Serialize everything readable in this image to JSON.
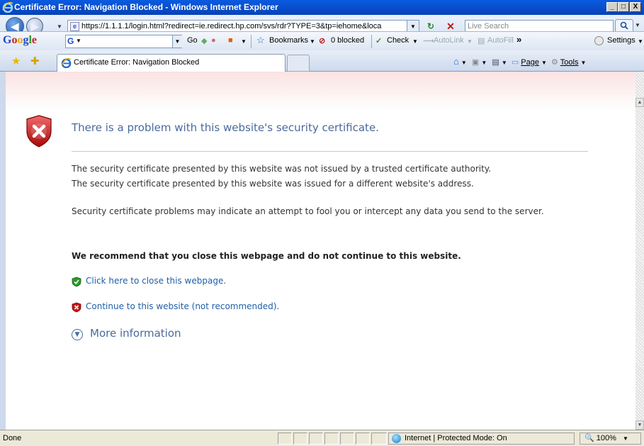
{
  "window": {
    "title": "Certificate Error: Navigation Blocked - Windows Internet Explorer",
    "min_glyph": "_",
    "max_glyph": "□",
    "close_glyph": "X"
  },
  "addressbar": {
    "url": "https://1.1.1.1/login.html?redirect=ie.redirect.hp.com/svs/rdr?TYPE=3&tp=iehome&loca",
    "search_placeholder": "Live Search"
  },
  "googlebar": {
    "logo": [
      "G",
      "o",
      "o",
      "g",
      "l",
      "e"
    ],
    "search_prefix": "G",
    "go_label": "Go",
    "bookmarks_label": "Bookmarks",
    "blocked_label": "0 blocked",
    "check_label": "Check",
    "autolink_label": "AutoLink",
    "autofill_label": "AutoFill",
    "more_label": "»",
    "settings_label": "Settings"
  },
  "tabs": {
    "active_label": "Certificate Error: Navigation Blocked"
  },
  "commandbar": {
    "page_label": "Page",
    "tools_label": "Tools"
  },
  "content": {
    "headline": "There is a problem with this website's security certificate.",
    "p1_line1": "The security certificate presented by this website was not issued by a trusted certificate authority.",
    "p1_line2": "The security certificate presented by this website was issued for a different website's address.",
    "p2": "Security certificate problems may indicate an attempt to fool you or intercept any data you send to the server.",
    "recommend": "We recommend that you close this webpage and do not continue to this website.",
    "close_link": "Click here to close this webpage.",
    "continue_link": "Continue to this website (not recommended).",
    "more_info": "More information"
  },
  "statusbar": {
    "status": "Done",
    "zone": "Internet | Protected Mode: On",
    "zoom": "100%"
  },
  "colors": {
    "titlebar": "#0a5be0",
    "headline": "#4a6a9c",
    "link": "#2060a8",
    "shield_red": "#c81818",
    "shield_green": "#2a9a2a"
  }
}
